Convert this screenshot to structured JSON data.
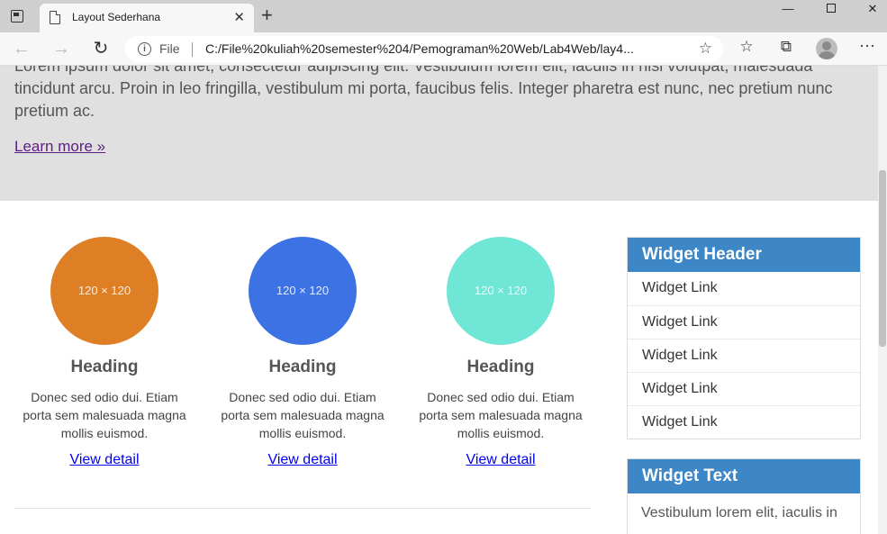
{
  "browser": {
    "tab_title": "Layout Sederhana",
    "address_scheme": "File",
    "url": "C:/File%20kuliah%20semester%204/Pemograman%20Web/Lab4Web/lay4...",
    "icons": {
      "window": "window-menu-icon",
      "tab_page": "document-icon",
      "tab_close": "close-icon",
      "new_tab": "plus-icon",
      "back": "back-arrow-icon",
      "forward": "forward-arrow-icon",
      "reload": "reload-icon",
      "site_info": "info-icon",
      "add_favorite": "star-plus-icon",
      "favorites": "favorites-icon",
      "collections": "collections-icon",
      "profile": "profile-avatar-icon",
      "more": "more-dots-icon"
    },
    "glyphs": {
      "tab_close": "✕",
      "new_tab": "+",
      "back": "←",
      "forward": "→",
      "reload": "↻",
      "info": "i",
      "fav_add": "☆",
      "favorites": "☆",
      "collections": "⧉",
      "more": "···",
      "minimize": "—",
      "close": "✕"
    }
  },
  "jumbotron": {
    "text": "Lorem ipsum dolor sit amet, consectetur adipiscing elit. Vestibulum lorem elit, iaculis in nisl volutpat, malesuada tincidunt arcu. Proin in leo fringilla, vestibulum mi porta, faucibus felis. Integer pharetra est nunc, nec pretium nunc pretium ac.",
    "link": "Learn more »"
  },
  "features": [
    {
      "image_label": "120 × 120",
      "color": "#de7f26",
      "heading": "Heading",
      "text": "Donec sed odio dui. Etiam porta sem malesuada magna mollis euismod.",
      "link": "View detail"
    },
    {
      "image_label": "120 × 120",
      "color": "#3c72e3",
      "heading": "Heading",
      "text": "Donec sed odio dui. Etiam porta sem malesuada magna mollis euismod.",
      "link": "View detail"
    },
    {
      "image_label": "120 × 120",
      "color": "#6fe6d6",
      "heading": "Heading",
      "text": "Donec sed odio dui. Etiam porta sem malesuada magna mollis euismod.",
      "link": "View detail"
    }
  ],
  "sidebar": {
    "widget_links": {
      "header": "Widget Header",
      "links": [
        "Widget Link",
        "Widget Link",
        "Widget Link",
        "Widget Link",
        "Widget Link"
      ]
    },
    "widget_text": {
      "header": "Widget Text",
      "text": "Vestibulum lorem elit, iaculis in"
    }
  },
  "colors": {
    "jumbotron_bg": "#e0e0e0",
    "widget_header_bg": "#3d87c7",
    "link": "#0000ee",
    "visited_link": "#5a1f80"
  }
}
